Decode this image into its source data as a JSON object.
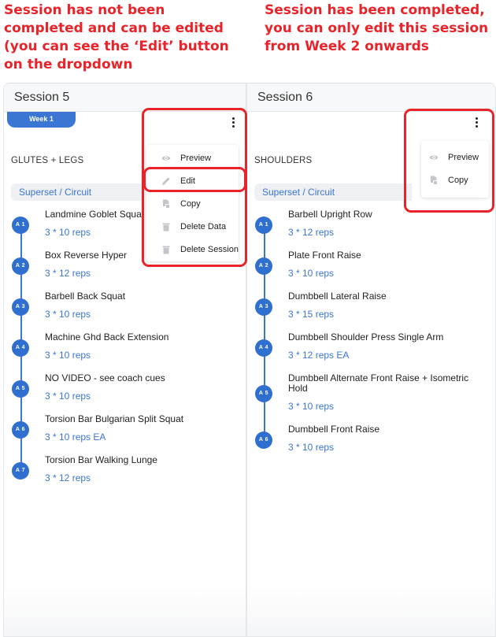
{
  "annotations": {
    "left": {
      "pre": "Session has ",
      "bold": "not",
      "post": " been completed and can be edited (you can see the ‘Edit’ button on the dropdown"
    },
    "right": {
      "text": "Session has been completed, you can only edit this session from ",
      "bold": "Week 2",
      "post": " onwards"
    }
  },
  "colors": {
    "annotation_red": "#e8232a",
    "accent_blue": "#3b76d4",
    "badge_blue": "#2f6fd0"
  },
  "sessions": [
    {
      "title": "Session 5",
      "week_label": "Week 1",
      "group_title": "GLUTES + LEGS",
      "group_type": "Superset / Circuit",
      "menu": [
        {
          "label": "Preview",
          "icon": "eye-icon"
        },
        {
          "label": "Edit",
          "icon": "pencil-icon"
        },
        {
          "label": "Copy",
          "icon": "copy-icon"
        },
        {
          "label": "Delete Data",
          "icon": "trash-icon"
        },
        {
          "label": "Delete Session",
          "icon": "trash-icon"
        }
      ],
      "exercises": [
        {
          "code": "A 1",
          "name": "Landmine Goblet Squat",
          "reps": "3 * 10 reps"
        },
        {
          "code": "A 2",
          "name": "Box Reverse Hyper",
          "reps": "3 * 12 reps"
        },
        {
          "code": "A 3",
          "name": "Barbell Back Squat",
          "reps": "3 * 10 reps"
        },
        {
          "code": "A 4",
          "name": "Machine Ghd Back Extension",
          "reps": "3 * 10 reps"
        },
        {
          "code": "A 5",
          "name": "NO VIDEO - see coach cues",
          "reps": "3 * 10 reps"
        },
        {
          "code": "A 6",
          "name": "Torsion Bar Bulgarian Split Squat",
          "reps": "3 * 10 reps EA"
        },
        {
          "code": "A 7",
          "name": "Torsion Bar Walking Lunge",
          "reps": "3 * 12 reps"
        }
      ]
    },
    {
      "title": "Session 6",
      "group_title": "SHOULDERS",
      "group_type": "Superset / Circuit",
      "menu": [
        {
          "label": "Preview",
          "icon": "eye-icon"
        },
        {
          "label": "Copy",
          "icon": "copy-icon"
        }
      ],
      "exercises": [
        {
          "code": "A 1",
          "name": "Barbell Upright Row",
          "reps": "3 * 12 reps"
        },
        {
          "code": "A 2",
          "name": "Plate Front Raise",
          "reps": "3 * 10 reps"
        },
        {
          "code": "A 3",
          "name": "Dumbbell Lateral Raise",
          "reps": "3 * 15 reps"
        },
        {
          "code": "A 4",
          "name": "Dumbbell Shoulder Press Single Arm",
          "reps": "3 * 12 reps EA"
        },
        {
          "code": "A 5",
          "name": "Dumbbell Alternate Front Raise + Isometric Hold",
          "reps": "3 * 10 reps"
        },
        {
          "code": "A 6",
          "name": "Dumbbell Front Raise",
          "reps": "3 * 10 reps"
        }
      ]
    }
  ]
}
